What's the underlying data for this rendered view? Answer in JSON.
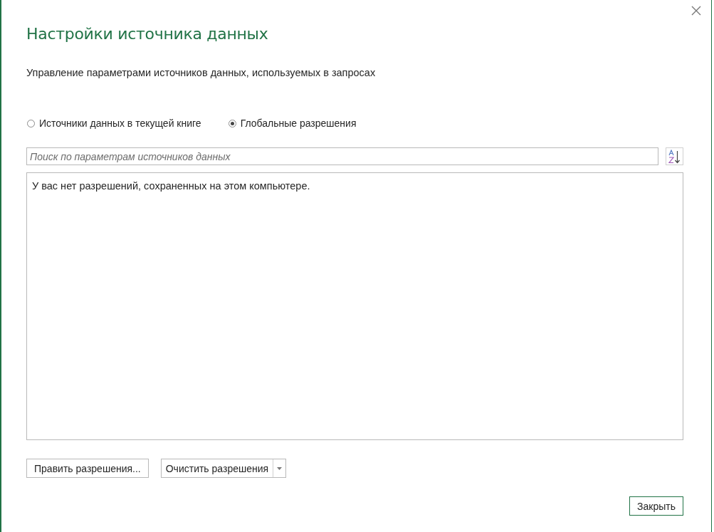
{
  "dialog": {
    "title": "Настройки источника данных",
    "subtitle": "Управление параметрами источников данных, используемых в запросах"
  },
  "scope_options": [
    {
      "label": "Источники данных в текущей книге",
      "selected": false
    },
    {
      "label": "Глобальные разрешения",
      "selected": true
    }
  ],
  "search": {
    "placeholder": "Поиск по параметрам источников данных"
  },
  "permissions_list": {
    "empty_message": "У вас нет разрешений, сохраненных на этом компьютере."
  },
  "buttons": [
    {
      "label": "Править разрешения...",
      "kind": "plain"
    },
    {
      "label": "Очистить разрешения",
      "kind": "split"
    }
  ],
  "close_button": {
    "label": "Закрыть"
  }
}
